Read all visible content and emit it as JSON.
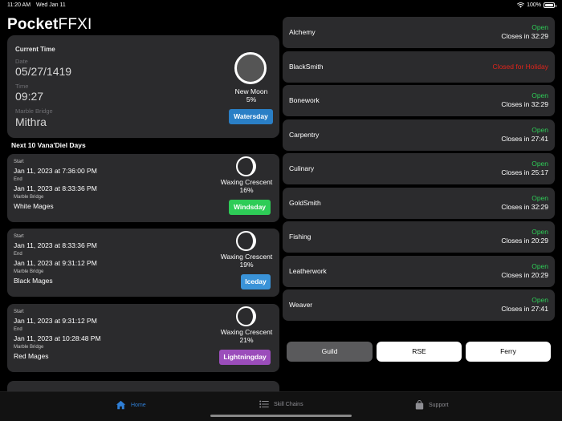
{
  "status_bar": {
    "time": "11:20 AM",
    "date": "Wed Jan 11",
    "battery": "100%",
    "battery_level": 1.0
  },
  "app": {
    "title_bold": "Pocket",
    "title_light": "FFXI"
  },
  "current": {
    "title": "Current Time",
    "date_label": "Date",
    "date": "05/27/1419",
    "time_label": "Time",
    "time": "09:27",
    "bridge_label": "Marble Bridge",
    "bridge": "Mithra",
    "moon_name": "New Moon",
    "moon_pct": "5%",
    "day": "Watersday",
    "day_color": "#2a7fc6"
  },
  "next_heading": "Next 10 Vana'Diel Days",
  "days": [
    {
      "start_label": "Start",
      "start": "Jan 11, 2023 at 7:36:00 PM",
      "end_label": "End",
      "end": "Jan 11, 2023 at 8:33:36 PM",
      "bridge_label": "Marble Bridge",
      "bridge": "White Mages",
      "moon_name": "Waxing Crescent",
      "moon_pct": "16%",
      "day": "Windsday",
      "day_color": "#2ecc57"
    },
    {
      "start_label": "Start",
      "start": "Jan 11, 2023 at 8:33:36 PM",
      "end_label": "End",
      "end": "Jan 11, 2023 at 9:31:12 PM",
      "bridge_label": "Marble Bridge",
      "bridge": "Black Mages",
      "moon_name": "Waxing Crescent",
      "moon_pct": "19%",
      "day": "Iceday",
      "day_color": "#3a93d8"
    },
    {
      "start_label": "Start",
      "start": "Jan 11, 2023 at 9:31:12 PM",
      "end_label": "End",
      "end": "Jan 11, 2023 at 10:28:48 PM",
      "bridge_label": "Marble Bridge",
      "bridge": "Red Mages",
      "moon_name": "Waxing Crescent",
      "moon_pct": "21%",
      "day": "Lightningday",
      "day_color": "#9b4dbb"
    }
  ],
  "guilds": [
    {
      "name": "Alchemy",
      "status": "Open",
      "closes": "Closes in 32:29"
    },
    {
      "name": "BlackSmith",
      "status": "Closed for Holiday",
      "closes": ""
    },
    {
      "name": "Bonework",
      "status": "Open",
      "closes": "Closes in 32:29"
    },
    {
      "name": "Carpentry",
      "status": "Open",
      "closes": "Closes in 27:41"
    },
    {
      "name": "Culinary",
      "status": "Open",
      "closes": "Closes in 25:17"
    },
    {
      "name": "GoldSmith",
      "status": "Open",
      "closes": "Closes in 32:29"
    },
    {
      "name": "Fishing",
      "status": "Open",
      "closes": "Closes in 20:29"
    },
    {
      "name": "Leatherwork",
      "status": "Open",
      "closes": "Closes in 20:29"
    },
    {
      "name": "Weaver",
      "status": "Open",
      "closes": "Closes in 27:41"
    }
  ],
  "colors": {
    "open": "#2ecc57",
    "closed": "#e0241b",
    "accent": "#2f7fd6"
  },
  "segments": {
    "guild": "Guild",
    "rse": "RSE",
    "ferry": "Ferry",
    "selected": "Guild"
  },
  "tabs": [
    {
      "label": "Home",
      "icon": "house-icon",
      "active": true
    },
    {
      "label": "Skill Chains",
      "icon": "list-icon",
      "active": false
    },
    {
      "label": "Support",
      "icon": "bag-icon",
      "active": false
    }
  ]
}
